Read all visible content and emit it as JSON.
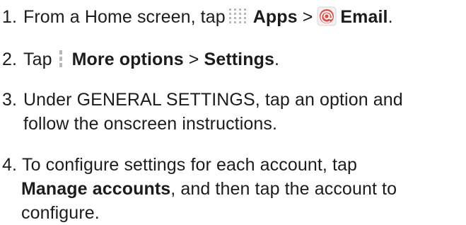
{
  "steps": [
    {
      "number": "1.",
      "before": "From a Home screen, tap",
      "icon_a": "apps-grid-icon",
      "bold_a": "Apps",
      "sep": ">",
      "icon_b": "email-icon",
      "bold_b": "Email",
      "after": "."
    },
    {
      "number": "2.",
      "before": "Tap",
      "icon_a": "more-options-icon",
      "bold_a": "More options",
      "sep": ">",
      "bold_b": "Settings",
      "after": "."
    },
    {
      "number": "3.",
      "line1": "Under GENERAL SETTINGS, tap an option and",
      "line2": "follow the onscreen instructions."
    },
    {
      "number": "4.",
      "line1": "To configure settings for each account, tap",
      "bold": "Manage accounts",
      "line2_rest": ", and then tap the account to",
      "line3": "configure."
    }
  ],
  "colors": {
    "text": "#1c1c1c",
    "icon_gray": "#b8b8b8",
    "email_red": "#e8473f"
  }
}
